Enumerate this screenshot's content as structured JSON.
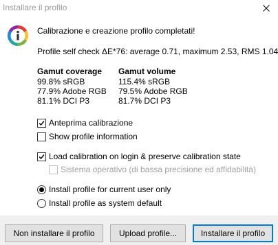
{
  "window": {
    "title": "Installare il profilo",
    "close_icon": "close-icon"
  },
  "icon": {
    "name": "info-icon",
    "glyph": "i"
  },
  "message": {
    "heading": "Calibrazione e creazione profilo completati!",
    "self_check": "Profile self check ΔE*76: average 0.71, maximum 2.53, RMS 1.04"
  },
  "gamut": {
    "coverage_header": "Gamut coverage",
    "coverage": [
      "99.8% sRGB",
      "77.9% Adobe RGB",
      "81.1% DCI P3"
    ],
    "volume_header": "Gamut volume",
    "volume": [
      "115.4% sRGB",
      "79.5% Adobe RGB",
      "81.7% DCI P3"
    ]
  },
  "options": {
    "preview_calibration": {
      "label": "Anteprima calibrazione",
      "checked": true
    },
    "show_profile_info": {
      "label": "Show profile information",
      "checked": false
    },
    "load_calibration": {
      "label": "Load calibration on login & preserve calibration state",
      "checked": true
    },
    "system_os": {
      "label": "Sistema operativo (di bassa precisione ed affidabilità)",
      "checked": false,
      "disabled": true
    }
  },
  "install_scope": {
    "current_user": {
      "label": "Install profile for current user only",
      "selected": true
    },
    "system_default": {
      "label": "Install profile as system default",
      "selected": false
    }
  },
  "buttons": {
    "dont_install": "Non installare il profilo",
    "upload": "Upload profile...",
    "install": "Installare il profilo"
  },
  "colors": {
    "accent": "#0078d7",
    "footer_bg": "#f0f0f0",
    "button_bg": "#e1e1e1"
  }
}
